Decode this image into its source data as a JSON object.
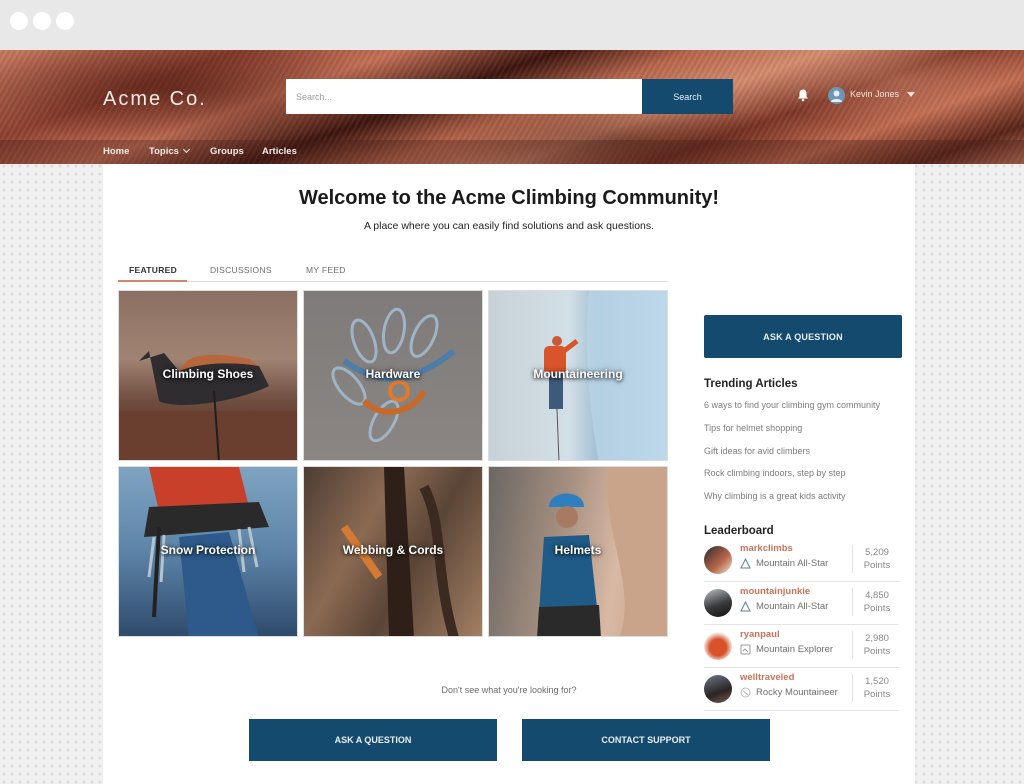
{
  "window": {
    "controls": [
      "close",
      "minimize",
      "maximize"
    ]
  },
  "header": {
    "logo": "Acme Co.",
    "search": {
      "placeholder": "Search...",
      "value": "",
      "button_label": "Search"
    },
    "notifications_icon": "bell-icon",
    "user": {
      "name": "Kevin Jones",
      "avatar_icon": "user-avatar-icon",
      "menu_icon": "caret-down-icon"
    }
  },
  "nav": {
    "items": [
      {
        "label": "Home"
      },
      {
        "label": "Topics",
        "has_dropdown": true
      },
      {
        "label": "Groups"
      },
      {
        "label": "Articles"
      }
    ]
  },
  "main": {
    "title": "Welcome to the Acme Climbing Community!",
    "subtitle": "A place where you can easily find solutions and ask questions.",
    "tabs": [
      {
        "label": "FEATURED",
        "active": true
      },
      {
        "label": "DISCUSSIONS",
        "active": false
      },
      {
        "label": "MY FEED",
        "active": false
      }
    ],
    "topics": [
      {
        "label": "Climbing Shoes"
      },
      {
        "label": "Hardware"
      },
      {
        "label": "Mountaineering"
      },
      {
        "label": "Snow Protection"
      },
      {
        "label": "Webbing & Cords"
      },
      {
        "label": "Helmets"
      }
    ],
    "footer_prompt": "Don't see what you're looking for?",
    "footer_buttons": {
      "ask": "ASK A QUESTION",
      "contact": "CONTACT SUPPORT"
    }
  },
  "sidebar": {
    "ask_button": "ASK A QUESTION",
    "trending_title": "Trending Articles",
    "trending": [
      "6 ways to find your climbing gym community",
      "Tips for helmet shopping",
      "Gift ideas for avid climbers",
      "Rock climbing indoors, step by step",
      "Why climbing is a great kids activity"
    ],
    "leaderboard_title": "Leaderboard",
    "leaderboard": [
      {
        "name": "markclimbs",
        "rank": "Mountain All-Star",
        "badge_icon": "triangle-mountain-icon",
        "points": "5,209",
        "points_label": "Points"
      },
      {
        "name": "mountainjunkie",
        "rank": "Mountain All-Star",
        "badge_icon": "triangle-mountain-icon",
        "points": "4,850",
        "points_label": "Points"
      },
      {
        "name": "ryanpaul",
        "rank": "Mountain Explorer",
        "badge_icon": "map-badge-icon",
        "points": "2,980",
        "points_label": "Points"
      },
      {
        "name": "welltraveled",
        "rank": "Rocky Mountaineer",
        "badge_icon": "circle-badge-icon",
        "points": "1,520",
        "points_label": "Points"
      }
    ]
  },
  "colors": {
    "primary_button": "#134a6e",
    "accent": "#c8735a",
    "tab_underline": "#d4866a"
  }
}
